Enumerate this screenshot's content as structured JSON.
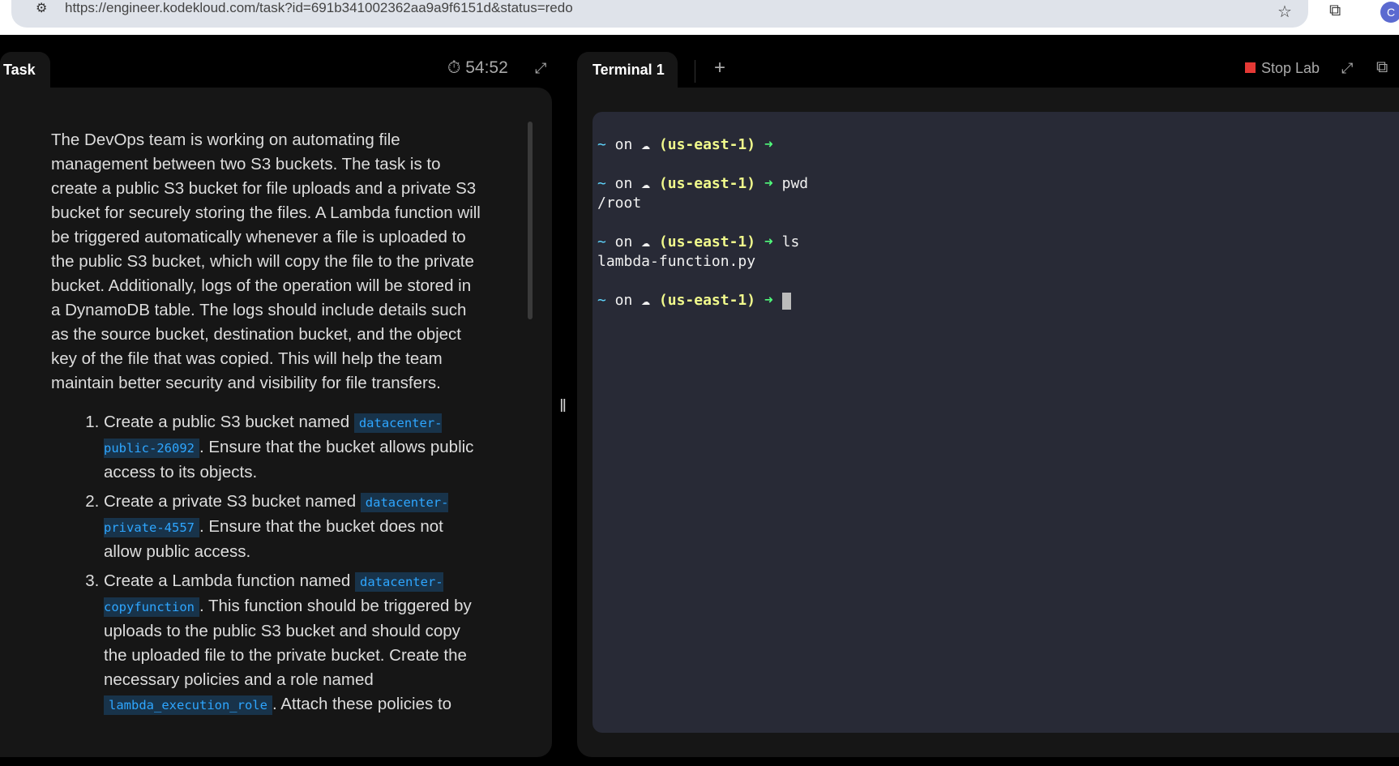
{
  "browser": {
    "url": "https://engineer.kodekloud.com/task?id=691b341002362aa9a9f6151d&status=redo",
    "avatar": "C"
  },
  "task_panel": {
    "tab_label": "Task",
    "timer": "54:52",
    "intro": "The DevOps team is working on automating file management between two S3 buckets. The task is to create a public S3 bucket for file uploads and a private S3 bucket for securely storing the files. A Lambda function will be triggered automatically whenever a file is uploaded to the public S3 bucket, which will copy the file to the private bucket. Additionally, logs of the operation will be stored in a DynamoDB table. The logs should include details such as the source bucket, destination bucket, and the object key of the file that was copied. This will help the team maintain better security and visibility for file transfers.",
    "steps": [
      {
        "before": "Create a public S3 bucket named ",
        "code": "datacenter-public-26092",
        "after": ". Ensure that the bucket allows public access to its objects."
      },
      {
        "before": "Create a private S3 bucket named ",
        "code": "datacenter-private-4557",
        "after": ". Ensure that the bucket does not allow public access."
      },
      {
        "before": "Create a Lambda function named ",
        "code": "datacenter-copyfunction",
        "after": ". This function should be triggered by uploads to the public S3 bucket and should copy the uploaded file to the private bucket. Create the necessary policies and a role named ",
        "code2": "lambda_execution_role",
        "after2": ". Attach these policies to"
      }
    ]
  },
  "terminal_panel": {
    "tab_label": "Terminal 1",
    "add_tab": "+",
    "stop_lab": "Stop Lab",
    "prompt": {
      "tilde": "~",
      "on": " on ",
      "cloud": "☁",
      "region": "(us-east-1)",
      "arrow": "➜"
    },
    "lines": [
      {
        "cmd": "",
        "output": ""
      },
      {
        "cmd": "pwd",
        "output": "/root"
      },
      {
        "cmd": "ls",
        "output": "lambda-function.py"
      }
    ]
  },
  "colors": {
    "code_text": "#2ea6ff",
    "region": "#f1fa8c",
    "arrow": "#50fa7b",
    "stop": "#e53935"
  }
}
